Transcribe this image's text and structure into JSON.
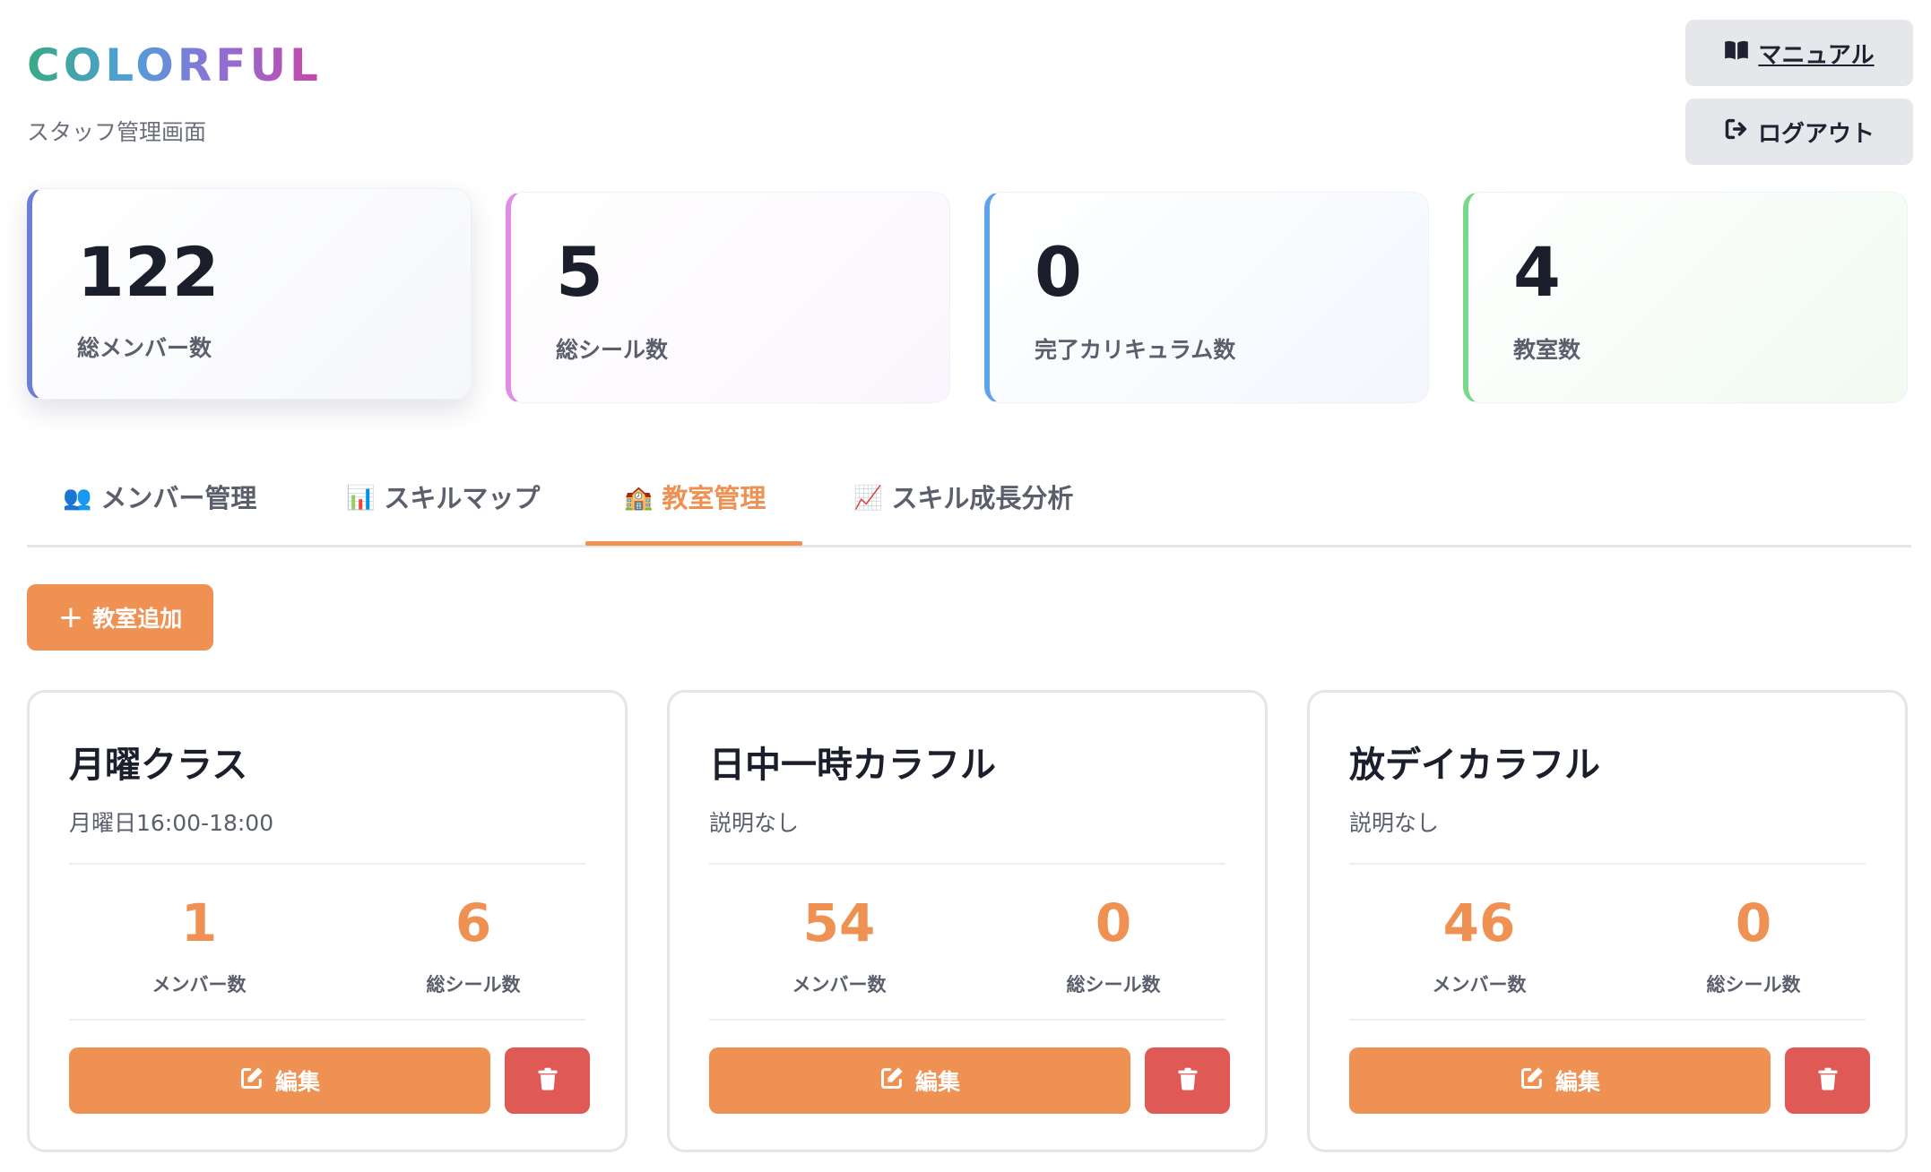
{
  "header": {
    "logo": "COLORFUL",
    "subtitle": "スタッフ管理画面",
    "manual_label": "マニュアル",
    "logout_label": "ログアウト"
  },
  "stats": [
    {
      "value": "122",
      "label": "総メンバー数",
      "accent": "#6b7fd7"
    },
    {
      "value": "5",
      "label": "総シール数",
      "accent": "#e08be6"
    },
    {
      "value": "0",
      "label": "完了カリキュラム数",
      "accent": "#5fa3ea"
    },
    {
      "value": "4",
      "label": "教室数",
      "accent": "#7ad88a"
    }
  ],
  "tabs": [
    {
      "icon": "👥",
      "label": "メンバー管理",
      "active": false
    },
    {
      "icon": "📊",
      "label": "スキルマップ",
      "active": false
    },
    {
      "icon": "🏫",
      "label": "教室管理",
      "active": true
    },
    {
      "icon": "📈",
      "label": "スキル成長分析",
      "active": false
    }
  ],
  "actions": {
    "add_classroom_label": "教室追加"
  },
  "classrooms": [
    {
      "name": "月曜クラス",
      "description": "月曜日16:00-18:00",
      "members_value": "1",
      "members_label": "メンバー数",
      "seals_value": "6",
      "seals_label": "総シール数",
      "edit_label": "編集"
    },
    {
      "name": "日中一時カラフル",
      "description": "説明なし",
      "members_value": "54",
      "members_label": "メンバー数",
      "seals_value": "0",
      "seals_label": "総シール数",
      "edit_label": "編集"
    },
    {
      "name": "放デイカラフル",
      "description": "説明なし",
      "members_value": "46",
      "members_label": "メンバー数",
      "seals_value": "0",
      "seals_label": "総シール数",
      "edit_label": "編集"
    }
  ],
  "colors": {
    "accent": "#ef9152",
    "danger": "#e05a55",
    "button_gray": "#e6e7ea"
  }
}
